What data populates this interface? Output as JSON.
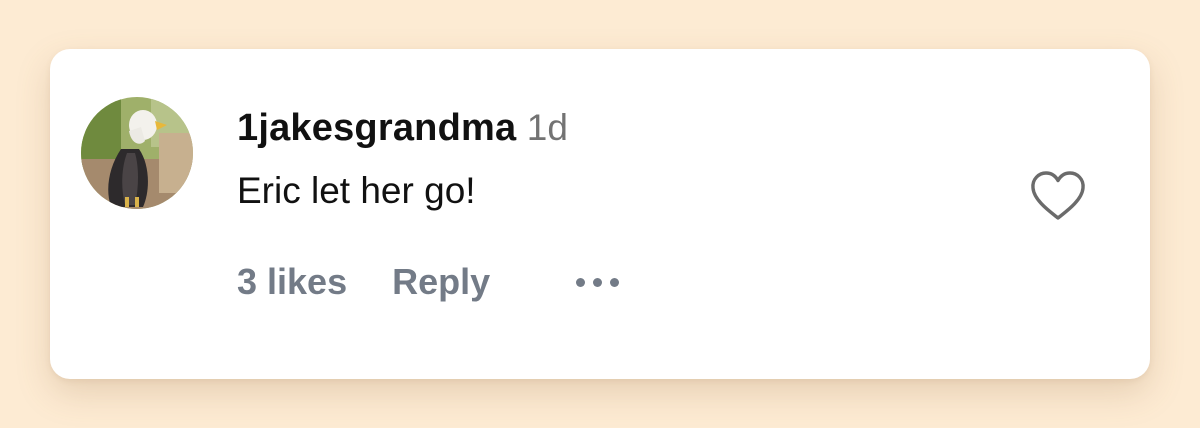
{
  "comment": {
    "username": "1jakesgrandma",
    "time": "1d",
    "text": "Eric let her go!",
    "likes_label": "3 likes",
    "reply_label": "Reply"
  },
  "icons": {
    "like": "heart-outline-icon",
    "more": "more-horizontal-icon"
  },
  "colors": {
    "background": "#fdebd3",
    "card": "#ffffff",
    "primary_text": "#111111",
    "secondary_text": "#737b87"
  }
}
